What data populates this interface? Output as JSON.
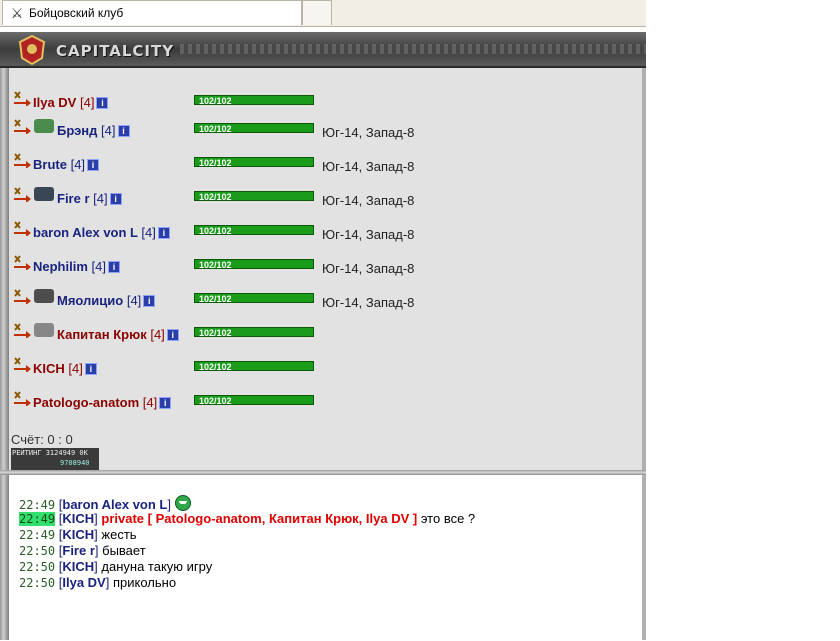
{
  "browser": {
    "tab_title": "Бойцовский клуб",
    "tab_icon": "crossed-swords-icon"
  },
  "header": {
    "logo": "CAPITALCITY"
  },
  "players": [
    {
      "name": "Ilya DV",
      "level": "[4]",
      "team": "red",
      "hp": "102/102",
      "location": "",
      "clan_icon": ""
    },
    {
      "name": "Брэнд",
      "level": "[4]",
      "team": "blue",
      "hp": "102/102",
      "location": "Юг-14, Запад-8",
      "clan_icon": "green-dragon-icon"
    },
    {
      "name": "Brute",
      "level": "[4]",
      "team": "blue",
      "hp": "102/102",
      "location": "Юг-14, Запад-8",
      "clan_icon": ""
    },
    {
      "name": "Fire r",
      "level": "[4]",
      "team": "blue",
      "hp": "102/102",
      "location": "Юг-14, Запад-8",
      "clan_icon": "dark-clan-icon"
    },
    {
      "name": "baron Alex von L",
      "level": "[4]",
      "team": "blue",
      "hp": "102/102",
      "location": "Юг-14, Запад-8",
      "clan_icon": ""
    },
    {
      "name": "Nephilim",
      "level": "[4]",
      "team": "blue",
      "hp": "102/102",
      "location": "Юг-14, Запад-8",
      "clan_icon": ""
    },
    {
      "name": "Мяолицио",
      "level": "[4]",
      "team": "blue",
      "hp": "102/102",
      "location": "Юг-14, Запад-8",
      "clan_icon": "pickaxe-clan-icon"
    },
    {
      "name": "Капитан Крюк",
      "level": "[4]",
      "team": "red",
      "hp": "102/102",
      "location": "",
      "clan_icon": "winged-clan-icon"
    },
    {
      "name": "KICH",
      "level": "[4]",
      "team": "red",
      "hp": "102/102",
      "location": "",
      "clan_icon": ""
    },
    {
      "name": "Patologo-anatom",
      "level": "[4]",
      "team": "red",
      "hp": "102/102",
      "location": "",
      "clan_icon": ""
    }
  ],
  "score": "Счёт: 0 : 0",
  "rating_widget": {
    "line1": "РЕЙТИНГ 3124949 0K",
    "line2": "9708940"
  },
  "chat": [
    {
      "time": "22:49",
      "nick": "baron Alex von L",
      "text": "",
      "private": "",
      "highlight": false,
      "smiley": true
    },
    {
      "time": "22:49",
      "nick": "KICH",
      "text": "это все ?",
      "private": "private [ Patologo-anatom, Капитан Крюк, Ilya DV ]",
      "highlight": true,
      "smiley": false
    },
    {
      "time": "22:49",
      "nick": "KICH",
      "text": "жесть",
      "private": "",
      "highlight": false,
      "smiley": false
    },
    {
      "time": "22:50",
      "nick": "Fire r",
      "text": "бывает",
      "private": "",
      "highlight": false,
      "smiley": false
    },
    {
      "time": "22:50",
      "nick": "KICH",
      "text": "дануна такую игру",
      "private": "",
      "highlight": false,
      "smiley": false
    },
    {
      "time": "22:50",
      "nick": "Ilya DV",
      "text": "прикольно",
      "private": "",
      "highlight": false,
      "smiley": false
    }
  ],
  "colors": {
    "team_red": "#8b0000",
    "team_blue": "#1a237e",
    "hp_bar": "#1a9b1a",
    "private_text": "#e10000"
  }
}
